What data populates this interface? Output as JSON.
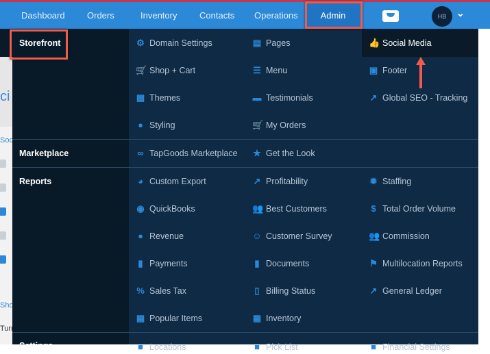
{
  "nav": {
    "items": [
      "Dashboard",
      "Orders",
      "Inventory",
      "Contacts",
      "Operations",
      "Admin"
    ],
    "avatar": "HB"
  },
  "background": {
    "heading_fragment": "ci",
    "tab1": "Soc",
    "tab2": "Sho",
    "text": "Turr"
  },
  "menu": {
    "storefront": {
      "label": "Storefront",
      "items": [
        {
          "label": "Domain Settings",
          "icon": "gear-icon"
        },
        {
          "label": "Pages",
          "icon": "pages-icon"
        },
        {
          "label": "Social Media",
          "icon": "thumbs-up-icon"
        },
        {
          "label": "Shop + Cart",
          "icon": "cart-icon"
        },
        {
          "label": "Menu",
          "icon": "menu-icon"
        },
        {
          "label": "Footer",
          "icon": "footer-icon"
        },
        {
          "label": "Themes",
          "icon": "themes-icon"
        },
        {
          "label": "Testimonials",
          "icon": "comment-icon"
        },
        {
          "label": "Global SEO - Tracking",
          "icon": "trend-icon"
        },
        {
          "label": "Styling",
          "icon": "droplet-icon"
        },
        {
          "label": "My Orders",
          "icon": "cart-icon"
        }
      ]
    },
    "marketplace": {
      "label": "Marketplace",
      "items": [
        {
          "label": "TapGoods Marketplace",
          "icon": "infinity-icon"
        },
        {
          "label": "Get the Look",
          "icon": "star-icon"
        }
      ]
    },
    "reports": {
      "label": "Reports",
      "items": [
        {
          "label": "Custom Export",
          "icon": "pie-icon"
        },
        {
          "label": "Profitability",
          "icon": "trend-icon"
        },
        {
          "label": "Staffing",
          "icon": "gear-badge-icon"
        },
        {
          "label": "QuickBooks",
          "icon": "quickbooks-icon"
        },
        {
          "label": "Best Customers",
          "icon": "users-icon"
        },
        {
          "label": "Total Order Volume",
          "icon": "dollar-doc-icon"
        },
        {
          "label": "Revenue",
          "icon": "money-bag-icon"
        },
        {
          "label": "Customer Survey",
          "icon": "smile-icon"
        },
        {
          "label": "Commission",
          "icon": "users-icon"
        },
        {
          "label": "Payments",
          "icon": "tag-icon"
        },
        {
          "label": "Documents",
          "icon": "file-icon"
        },
        {
          "label": "Multilocation Reports",
          "icon": "flag-icon"
        },
        {
          "label": "Sales Tax",
          "icon": "percent-icon"
        },
        {
          "label": "Billing Status",
          "icon": "receipt-icon"
        },
        {
          "label": "General Ledger",
          "icon": "trend-icon"
        },
        {
          "label": "Popular Items",
          "icon": "grid-icon"
        },
        {
          "label": "Inventory",
          "icon": "grid-icon"
        }
      ]
    },
    "settings": {
      "label": "Settings",
      "items": [
        {
          "label": "Locations"
        },
        {
          "label": "Pick List"
        },
        {
          "label": "Financial Settings"
        }
      ]
    }
  },
  "colors": {
    "nav": "#2b89d8",
    "menu_bg": "#0f2a44",
    "left_bg": "#081a28",
    "annotation": "#f25a4e"
  }
}
